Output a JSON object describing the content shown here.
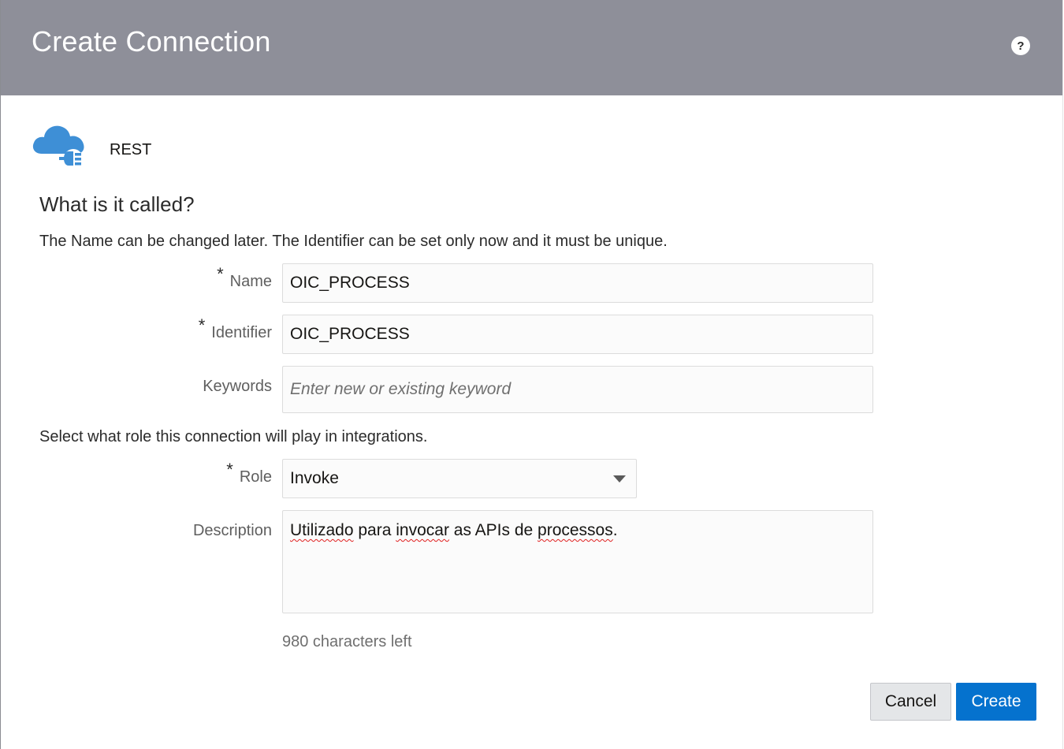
{
  "dialog": {
    "title": "Create Connection",
    "help_icon": "?"
  },
  "adapter": {
    "icon": "cloud-plug-icon",
    "name": "REST"
  },
  "section": {
    "title": "What is it called?",
    "helper": "The Name can be changed later. The Identifier can be set only now and it must be unique."
  },
  "fields": {
    "required_mark": "*",
    "name": {
      "label": "Name",
      "value": "OIC_PROCESS"
    },
    "identifier": {
      "label": "Identifier",
      "value": "OIC_PROCESS"
    },
    "keywords": {
      "label": "Keywords",
      "placeholder": "Enter new or existing keyword"
    },
    "role_helper": "Select what role this connection will play in integrations.",
    "role": {
      "label": "Role",
      "value": "Invoke"
    },
    "description": {
      "label": "Description",
      "parts": [
        "Utilizado",
        " para ",
        "invocar",
        " as APIs de ",
        "processos",
        "."
      ],
      "chars_left": "980 characters left"
    }
  },
  "buttons": {
    "cancel": "Cancel",
    "create": "Create"
  },
  "colors": {
    "header_bg": "#8e8f99",
    "primary": "#0572ce",
    "spellcheck": "#e02020"
  }
}
